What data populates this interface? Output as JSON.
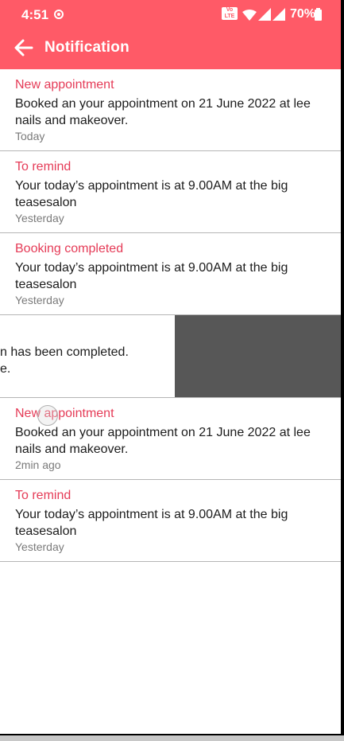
{
  "status": {
    "time": "4:51",
    "battery": "70%",
    "volte": "VoLTE"
  },
  "header": {
    "title": "Notification"
  },
  "notifications": [
    {
      "title": "New appointment",
      "body": "Booked an your appointment on  21 June 2022 at lee nails and makeover.",
      "time": "Today"
    },
    {
      "title": "To remind",
      "body": "Your today’s appointment is at 9.00AM at the big teasesalon",
      "time": "Yesterday"
    },
    {
      "title": "Booking completed",
      "body": "Your today’s appointment is at 9.00AM at the big teasesalon",
      "time": "Yesterday"
    },
    {
      "body_line1": "n  has been completed.",
      "body_line2": "e."
    },
    {
      "title": "New appointment",
      "body": "Booked an your appointment on  21 June 2022 at lee nails and makeover.",
      "time": "2min ago"
    },
    {
      "title": "To remind",
      "body": "Your today’s appointment is at 9.00AM at the big teasesalon",
      "time": "Yesterday"
    }
  ],
  "colors": {
    "header_bg": "#ff5a67",
    "title_text": "#e53b57",
    "swipe_bg": "#575757"
  }
}
